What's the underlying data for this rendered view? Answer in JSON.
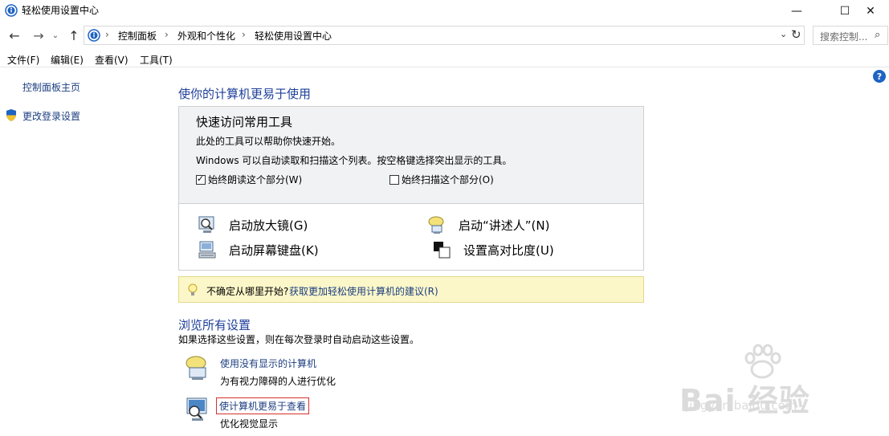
{
  "window": {
    "title": "轻松使用设置中心",
    "minimize_glyph": "—",
    "maximize_glyph": "☐",
    "close_glyph": "✕"
  },
  "address": {
    "crumbs": [
      "控制面板",
      "外观和个性化",
      "轻松使用设置中心"
    ],
    "separator": "›",
    "search_placeholder": "搜索控制..."
  },
  "menu": {
    "items": [
      "文件(F)",
      "编辑(E)",
      "查看(V)",
      "工具(T)"
    ]
  },
  "sidebar": {
    "home_link": "控制面板主页",
    "login_link": "更改登录设置"
  },
  "main": {
    "heading": "使你的计算机更易于使用",
    "quick_access": {
      "title": "快速访问常用工具",
      "desc1": "此处的工具可以帮助你快速开始。",
      "desc2": "Windows 可以自动读取和扫描这个列表。按空格键选择突出显示的工具。",
      "checkbox_read": "始终朗读这个部分(W)",
      "checkbox_read_checked": true,
      "checkbox_scan": "始终扫描这个部分(O)",
      "checkbox_scan_checked": false,
      "tools": {
        "magnifier": "启动放大镜(G)",
        "narrator": "启动“讲述人”(N)",
        "osk": "启动屏幕键盘(K)",
        "high_contrast": "设置高对比度(U)"
      }
    },
    "tip": {
      "text": "不确定从哪里开始?",
      "link": "获取更加轻松使用计算机的建议(R)"
    },
    "browse": {
      "heading": "浏览所有设置",
      "desc": "如果选择这些设置，则在每次登录时自动启动这些设置。",
      "items": [
        {
          "link": "使用没有显示的计算机",
          "desc": "为有视力障碍的人进行优化"
        },
        {
          "link": "使计算机更易于查看",
          "desc": "优化视觉显示"
        }
      ]
    }
  },
  "watermark": {
    "text": "Bai 经验",
    "sub": "jingyan.baidu.com"
  },
  "colors": {
    "link": "#1c3e80",
    "heading": "#1e3f9a",
    "highlight": "#d6302b",
    "tip_bg": "#fbf7c9"
  }
}
